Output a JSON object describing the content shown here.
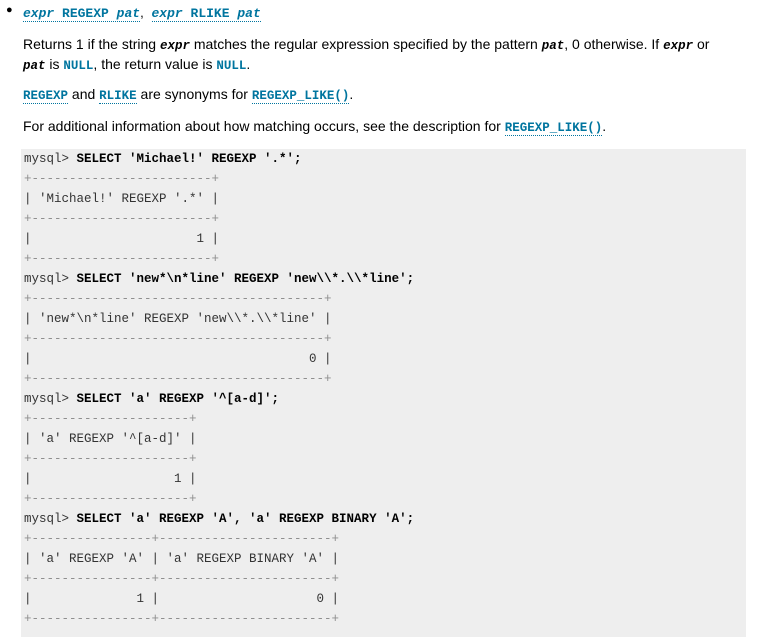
{
  "signature": {
    "expr1": "expr",
    "op1": "REGEXP",
    "pat1": "pat",
    "sep": ",",
    "expr2": "expr",
    "op2": "RLIKE",
    "pat2": "pat"
  },
  "para1": {
    "t1": "Returns 1 if the string ",
    "v1": "expr",
    "t2": " matches the regular expression specified by the pattern ",
    "v2": "pat",
    "t3": ", 0 otherwise. If ",
    "v3": "expr",
    "t4": " or",
    "v4": "pat",
    "t5": " is ",
    "k1": "NULL",
    "t6": ", the return value is ",
    "k2": "NULL",
    "t7": "."
  },
  "para2": {
    "l1": "REGEXP",
    "t1": " and ",
    "l2": "RLIKE",
    "t2": " are synonyms for ",
    "l3": "REGEXP_LIKE()",
    "t3": "."
  },
  "para3": {
    "t1": "For additional information about how matching occurs, see the description for ",
    "l1": "REGEXP_LIKE()",
    "t2": "."
  },
  "code": {
    "lines": [
      {
        "prompt": "mysql> ",
        "cmd": "SELECT 'Michael!' REGEXP '.*';"
      },
      {
        "border": "+------------------------+"
      },
      {
        "text": "| 'Michael!' REGEXP '.*' |"
      },
      {
        "border": "+------------------------+"
      },
      {
        "text": "|                      1 |"
      },
      {
        "border": "+------------------------+"
      },
      {
        "prompt": "mysql> ",
        "cmd": "SELECT 'new*\\n*line' REGEXP 'new\\\\*.\\\\*line';"
      },
      {
        "border": "+---------------------------------------+"
      },
      {
        "text": "| 'new*\\n*line' REGEXP 'new\\\\*.\\\\*line' |"
      },
      {
        "border": "+---------------------------------------+"
      },
      {
        "text": "|                                     0 |"
      },
      {
        "border": "+---------------------------------------+"
      },
      {
        "prompt": "mysql> ",
        "cmd": "SELECT 'a' REGEXP '^[a-d]';"
      },
      {
        "border": "+---------------------+"
      },
      {
        "text": "| 'a' REGEXP '^[a-d]' |"
      },
      {
        "border": "+---------------------+"
      },
      {
        "text": "|                   1 |"
      },
      {
        "border": "+---------------------+"
      },
      {
        "prompt": "mysql> ",
        "cmd": "SELECT 'a' REGEXP 'A', 'a' REGEXP BINARY 'A';"
      },
      {
        "border": "+----------------+-----------------------+"
      },
      {
        "text": "| 'a' REGEXP 'A' | 'a' REGEXP BINARY 'A' |"
      },
      {
        "border": "+----------------+-----------------------+"
      },
      {
        "text": "|              1 |                     0 |"
      },
      {
        "border": "+----------------+-----------------------+"
      }
    ]
  }
}
